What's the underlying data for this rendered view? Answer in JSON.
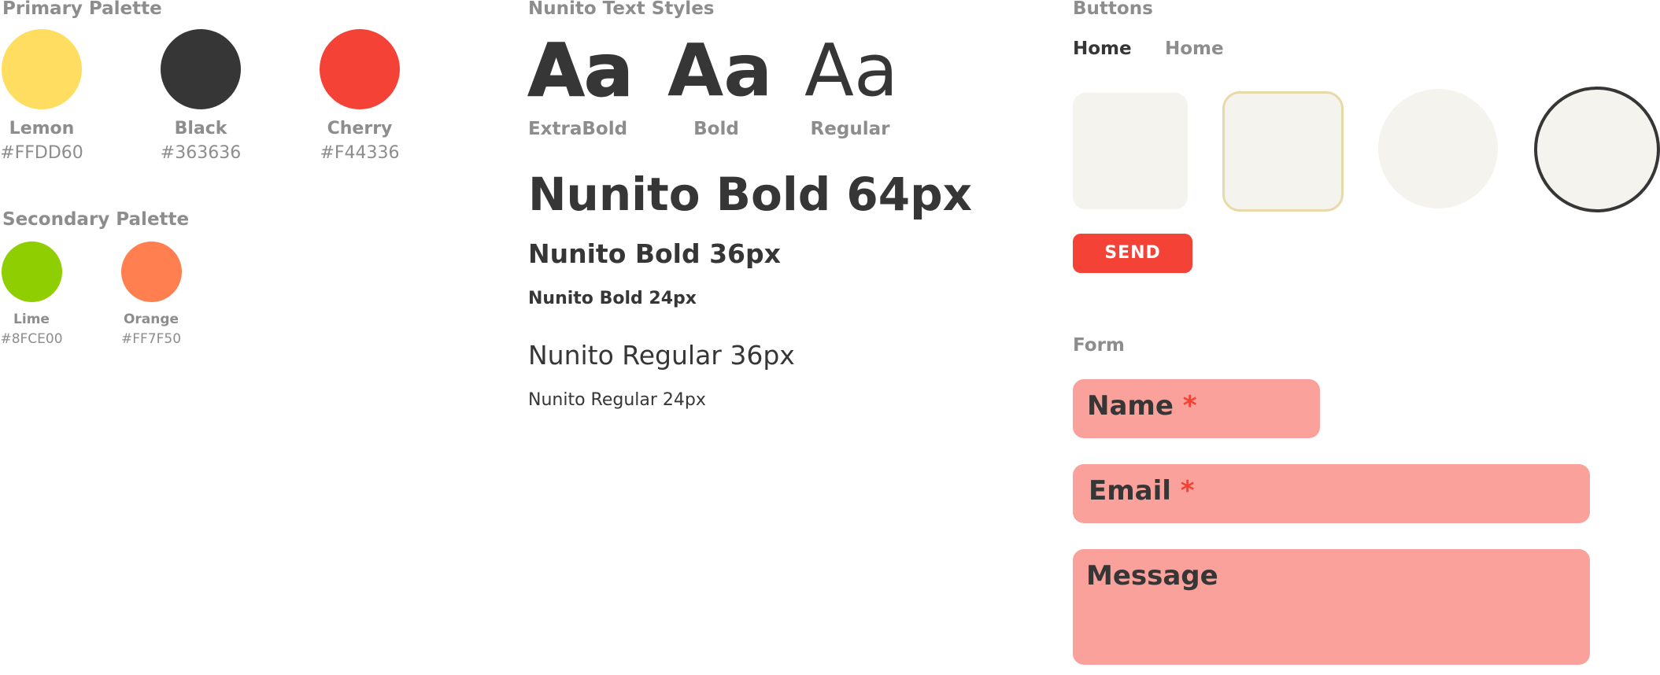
{
  "primary_palette": {
    "title": "Primary Palette",
    "colors": [
      {
        "name": "Lemon",
        "hex": "#FFDD60",
        "color": "#FFDD60"
      },
      {
        "name": "Black",
        "hex": "#363636",
        "color": "#363636"
      },
      {
        "name": "Cherry",
        "hex": "#F44336",
        "color": "#F44336"
      }
    ]
  },
  "secondary_palette": {
    "title": "Secondary Palette",
    "colors": [
      {
        "name": "Lime",
        "hex": "#8FCE00",
        "color": "#8FCE00"
      },
      {
        "name": "Orange",
        "hex": "#FF7F50",
        "color": "#FF7F50"
      }
    ]
  },
  "text_styles": {
    "title": "Nunito Text Styles",
    "weights": [
      {
        "sample": "Aa",
        "label": "ExtraBold"
      },
      {
        "sample": "Aa",
        "label": "Bold"
      },
      {
        "sample": "Aa",
        "label": "Regular"
      }
    ],
    "samples": [
      "Nunito Bold 64px",
      "Nunito Bold 36px",
      "Nunito Bold 24px",
      "Nunito Regular 36px",
      "Nunito Regular 24px"
    ]
  },
  "buttons": {
    "title": "Buttons",
    "nav_active": "Home",
    "nav_inactive": "Home",
    "send_label": "SEND"
  },
  "form": {
    "title": "Form",
    "name_label": "Name",
    "email_label": "Email",
    "message_label": "Message",
    "required_mark": "*"
  },
  "colors": {
    "accent": "#F44336",
    "field_bg": "#F9A19A",
    "button_bg": "#F5F3EE",
    "button_border_gold": "#E8D9A8",
    "muted_text": "#8D8D8D"
  }
}
